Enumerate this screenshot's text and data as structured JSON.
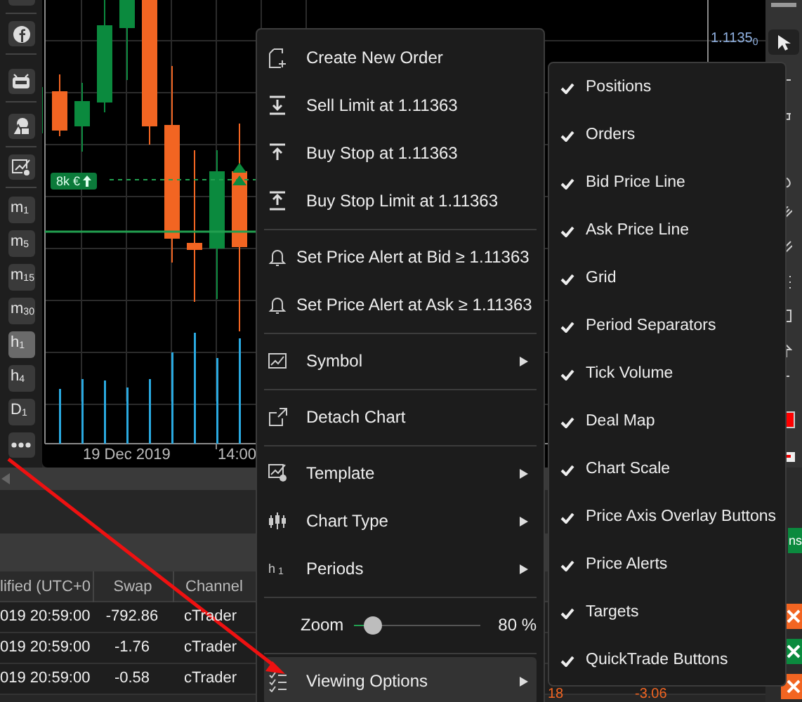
{
  "sidebar": {
    "periods": [
      {
        "label": "m$_{1}$",
        "selected": false
      },
      {
        "label": "m$_{5}$",
        "selected": false
      },
      {
        "label": "m$_{15}$",
        "selected": false
      },
      {
        "label": "m$_{30}$",
        "selected": false
      },
      {
        "label": "h$_{1}$",
        "selected": true
      },
      {
        "label": "h$_{4}$",
        "selected": false
      },
      {
        "label": "D$_{1}$",
        "selected": false
      }
    ]
  },
  "chart": {
    "price_label": "1.1135$_{0}$",
    "position_tag": "8k €",
    "time_labels": [
      "19 Dec 2019",
      "14:00"
    ]
  },
  "table": {
    "columns": [
      "lified (UTC+0",
      "Swap",
      "Channel"
    ],
    "rows": [
      [
        "019 20:59:00",
        "-792.86",
        "cTrader"
      ],
      [
        "019 20:59:00",
        "-1.76",
        "cTrader"
      ],
      [
        "019 20:59:00",
        "-0.58",
        "cTrader"
      ]
    ],
    "hidden_row_cells": [
      "18",
      "-3.06"
    ]
  },
  "right_panel": {
    "tab_fragment": "ns"
  },
  "context_menu": {
    "items": [
      {
        "kind": "item",
        "label": "Create New Order",
        "submenu": false,
        "selected": false
      },
      {
        "kind": "item",
        "label": "Sell Limit at 1.11363",
        "submenu": false,
        "selected": false
      },
      {
        "kind": "item",
        "label": "Buy Stop at 1.11363",
        "submenu": false,
        "selected": false
      },
      {
        "kind": "item",
        "label": "Buy Stop Limit at 1.11363",
        "submenu": false,
        "selected": false
      },
      {
        "kind": "separator"
      },
      {
        "kind": "item",
        "label": "Set Price Alert at Bid ≥ 1.11363",
        "submenu": false,
        "selected": false
      },
      {
        "kind": "item",
        "label": "Set Price Alert at Ask ≥ 1.11363",
        "submenu": false,
        "selected": false
      },
      {
        "kind": "separator"
      },
      {
        "kind": "item",
        "label": "Symbol",
        "submenu": true,
        "selected": false
      },
      {
        "kind": "separator"
      },
      {
        "kind": "item",
        "label": "Detach Chart",
        "submenu": false,
        "selected": false
      },
      {
        "kind": "separator"
      },
      {
        "kind": "item",
        "label": "Template",
        "submenu": true,
        "selected": false
      },
      {
        "kind": "item",
        "label": "Chart Type",
        "submenu": true,
        "selected": false
      },
      {
        "kind": "item",
        "label": "Periods",
        "icon_text": "h$_{1}$",
        "submenu": true,
        "selected": false
      },
      {
        "kind": "separator"
      },
      {
        "kind": "slider",
        "label": "Zoom",
        "level": 0.15,
        "reading": "80 %"
      },
      {
        "kind": "separator"
      },
      {
        "kind": "item",
        "label": "Viewing Options",
        "submenu": true,
        "selected": true
      }
    ]
  },
  "viewing_options": {
    "items": [
      {
        "label": "Positions",
        "checked": true
      },
      {
        "label": "Orders",
        "checked": true
      },
      {
        "label": "Bid Price Line",
        "checked": true
      },
      {
        "label": "Ask Price Line",
        "checked": true
      },
      {
        "label": "Grid",
        "checked": true
      },
      {
        "label": "Period Separators",
        "checked": true
      },
      {
        "label": "Tick Volume",
        "checked": true
      },
      {
        "label": "Deal Map",
        "checked": true
      },
      {
        "label": "Chart Scale",
        "checked": true
      },
      {
        "label": "Price Axis Overlay Buttons",
        "checked": true
      },
      {
        "label": "Price Alerts",
        "checked": true
      },
      {
        "label": "Targets",
        "checked": true
      },
      {
        "label": "QuickTrade Buttons",
        "checked": true
      }
    ]
  }
}
